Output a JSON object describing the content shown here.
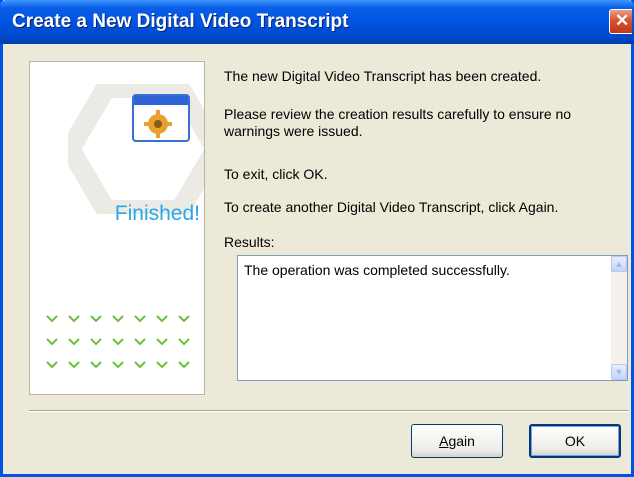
{
  "window": {
    "title": "Create a New Digital Video Transcript",
    "close_glyph": "✕"
  },
  "side_panel": {
    "status_label": "Finished!",
    "icon": "wizard-app-icon",
    "accent_color": "#2aa6e8",
    "chevron_color": "#6cbf3c"
  },
  "messages": {
    "created": "The new Digital Video Transcript has been created.",
    "review_line1": "Please review the creation results carefully to ensure no",
    "review_line2": "warnings were issued.",
    "exit": "To exit, click OK.",
    "again": "To create another Digital Video Transcript, click Again."
  },
  "results": {
    "label": "Results:",
    "text": "The operation was completed successfully."
  },
  "buttons": {
    "again_label": "Again",
    "again_mnemonic": "A",
    "ok_label": "OK"
  },
  "colors": {
    "title_bar": "#0054e3",
    "dialog_bg": "#ece9d8"
  }
}
